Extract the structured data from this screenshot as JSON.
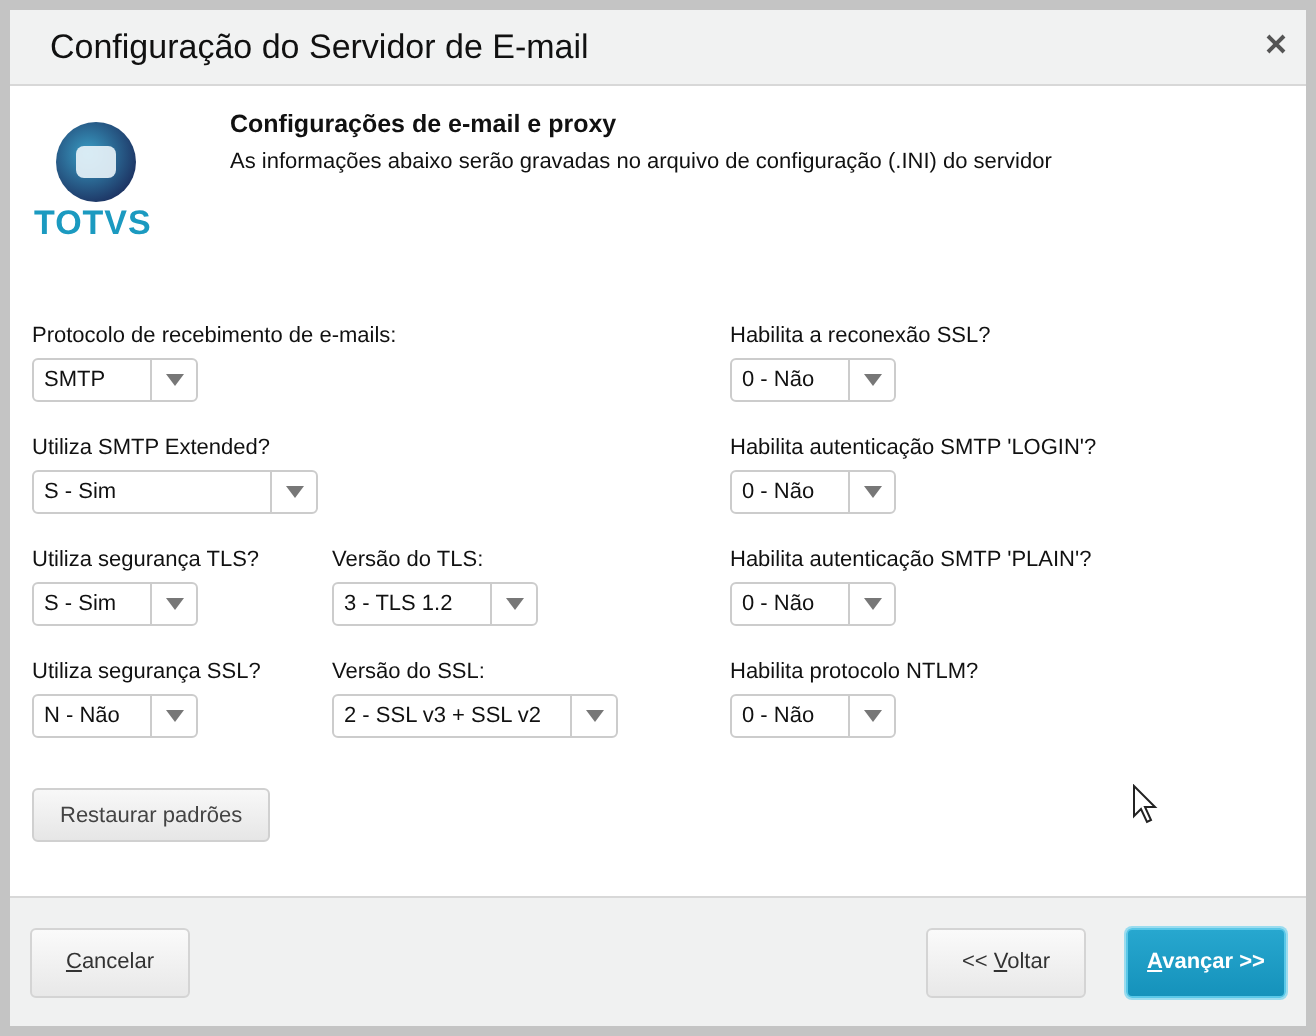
{
  "window": {
    "title": "Configuração do Servidor de E-mail"
  },
  "logo": {
    "text": "TOTVS"
  },
  "intro": {
    "heading": "Configurações de e-mail e proxy",
    "text": "As informações abaixo serão gravadas no arquivo de configuração (.INI) do servidor"
  },
  "left_rows": [
    [
      {
        "label": "Protocolo de recebimento de e-mails:",
        "value": "SMTP"
      }
    ],
    [
      {
        "label": "Utiliza SMTP Extended?",
        "value": "S - Sim"
      }
    ],
    [
      {
        "label": "Utiliza segurança TLS?",
        "value": "S - Sim"
      },
      {
        "label": "Versão do TLS:",
        "value": "3 - TLS 1.2"
      }
    ],
    [
      {
        "label": "Utiliza segurança SSL?",
        "value": "N - Não"
      },
      {
        "label": "Versão do SSL:",
        "value": "2 - SSL v3 + SSL v2"
      }
    ]
  ],
  "right_fields": [
    {
      "label": "Habilita a reconexão SSL?",
      "value": "0 - Não"
    },
    {
      "label": "Habilita autenticação SMTP 'LOGIN'?",
      "value": "0 - Não"
    },
    {
      "label": "Habilita autenticação SMTP 'PLAIN'?",
      "value": "0 - Não"
    },
    {
      "label": "Habilita protocolo NTLM?",
      "value": "0 - Não"
    }
  ],
  "restore_button": "Restaurar padrões",
  "footer_buttons": [
    {
      "key": "C",
      "after": "ancelar",
      "kind": "plain"
    },
    {
      "before": "<< ",
      "key": "V",
      "after": "oltar",
      "kind": "plain"
    },
    {
      "key": "A",
      "after": "vançar >>",
      "kind": "primary"
    }
  ]
}
